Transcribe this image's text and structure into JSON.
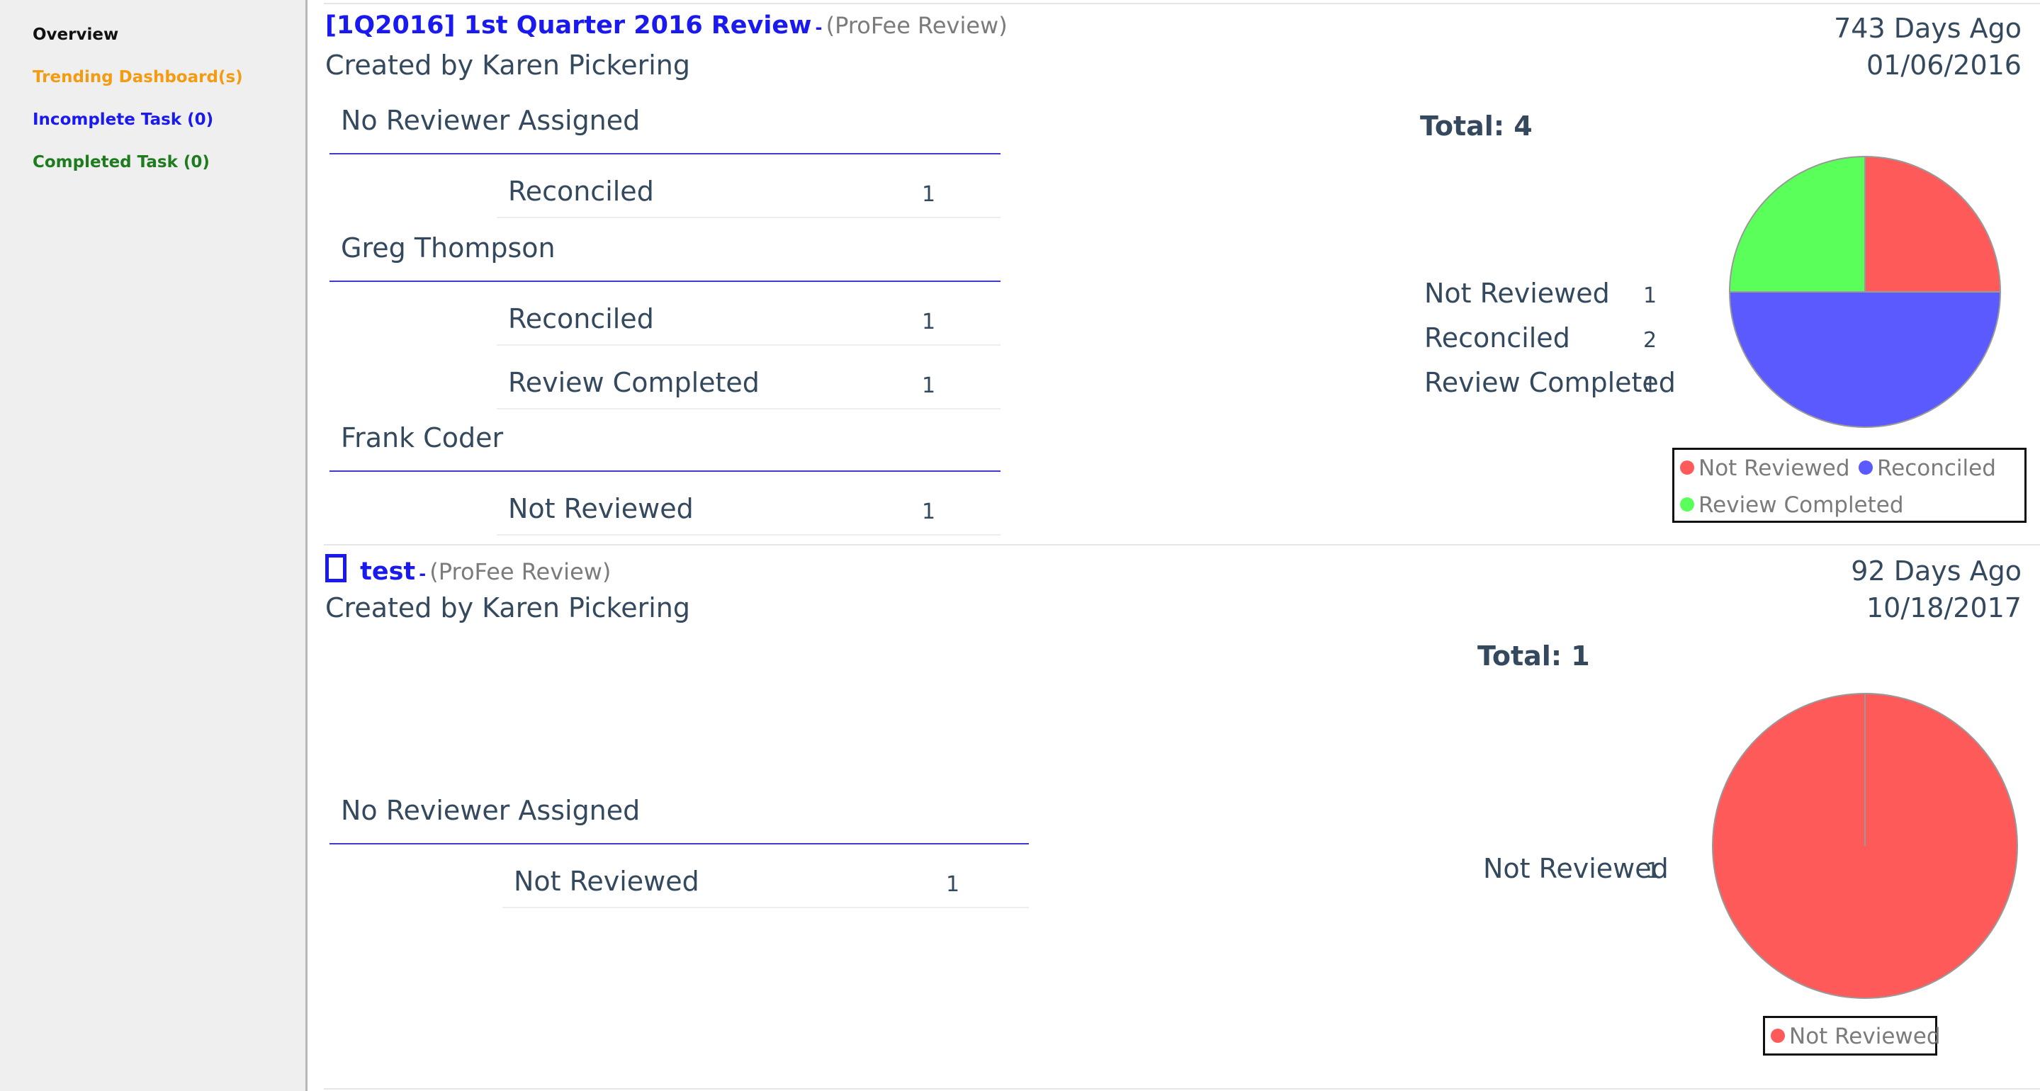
{
  "sidebar": {
    "items": [
      {
        "label": "Overview",
        "color": "#111111"
      },
      {
        "label": "Trending Dashboard(s)",
        "color": "#f39c12"
      },
      {
        "label": "Incomplete Task (0)",
        "color": "#1a1aee"
      },
      {
        "label": "Completed Task (0)",
        "color": "#1e7b1e"
      }
    ]
  },
  "colors": {
    "not_reviewed": "#ff5a5a",
    "reconciled": "#5a5aff",
    "review_completed": "#5aff5a",
    "link": "#1a1aee",
    "text": "#34495e"
  },
  "tasks": [
    {
      "title": "[1Q2016] 1st Quarter 2016 Review",
      "dash": "-",
      "type": "(ProFee Review)",
      "created_by": "Created by Karen Pickering",
      "days_ago": "743 Days Ago",
      "date": "01/06/2016",
      "groups": [
        {
          "reviewer": "No Reviewer Assigned",
          "rows": [
            {
              "label": "Reconciled",
              "count": "1"
            }
          ]
        },
        {
          "reviewer": "Greg Thompson",
          "rows": [
            {
              "label": "Reconciled",
              "count": "1"
            },
            {
              "label": "Review Completed",
              "count": "1"
            }
          ]
        },
        {
          "reviewer": "Frank Coder",
          "rows": [
            {
              "label": "Not Reviewed",
              "count": "1"
            }
          ]
        }
      ],
      "total": "Total: 4",
      "summary": [
        {
          "label": "Not Reviewed",
          "count": "1"
        },
        {
          "label": "Reconciled",
          "count": "2"
        },
        {
          "label": "Review Completed",
          "count": "1"
        }
      ],
      "legend": [
        "Not Reviewed",
        "Reconciled",
        "Review Completed"
      ]
    },
    {
      "title": "test",
      "dash": "-",
      "type": "(ProFee Review)",
      "created_by": "Created by Karen Pickering",
      "days_ago": "92 Days Ago",
      "date": "10/18/2017",
      "groups": [
        {
          "reviewer": "No Reviewer Assigned",
          "rows": [
            {
              "label": "Not Reviewed",
              "count": "1"
            }
          ]
        }
      ],
      "total": "Total: 1",
      "summary": [
        {
          "label": "Not Reviewed",
          "count": "1"
        }
      ],
      "legend": [
        "Not Reviewed"
      ]
    }
  ],
  "chart_data": [
    {
      "type": "pie",
      "categories": [
        "Not Reviewed",
        "Reconciled",
        "Review Completed"
      ],
      "values": [
        1,
        2,
        1
      ],
      "colors": [
        "#ff5a5a",
        "#5a5aff",
        "#5aff5a"
      ],
      "legend_position": "bottom"
    },
    {
      "type": "pie",
      "categories": [
        "Not Reviewed"
      ],
      "values": [
        1
      ],
      "colors": [
        "#ff5a5a"
      ],
      "legend_position": "bottom"
    }
  ]
}
